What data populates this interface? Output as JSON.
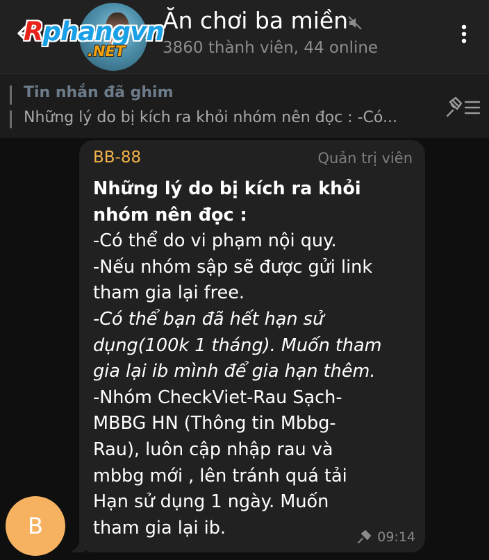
{
  "header": {
    "title": "Ăn chơi ba miền",
    "subtitle": "3860 thành viên, 44 online",
    "logo": {
      "main_first": "R",
      "main_rest": "phangvn",
      "sub": ".NET"
    }
  },
  "pinned": {
    "title": "Tin nhắn đã ghim",
    "preview": "Những lý do bị kích ra khỏi nhóm nên đọc : -Có..."
  },
  "message": {
    "sender": "BB-88",
    "role": "Quản trị viên",
    "lines": [
      "Những lý do bị kích ra khỏi",
      "nhóm nên đọc :",
      "-Có thể do vi phạm nội quy.",
      "-Nếu nhóm sập sẽ được gửi link",
      "tham gia lại free.",
      "-Có thể bạn đã hết hạn sử",
      "dụng(100k 1 tháng). Muốn tham",
      "gia lại ib mình để gia hạn thêm.",
      "-Nhóm CheckViet-Rau Sạch-",
      "MBBG HN (Thông tin Mbbg-",
      "Rau), luôn cập nhập rau và",
      "mbbg mới , lên tránh quá tải",
      "Hạn sử dụng 1 ngày.  Muốn",
      "tham gia lại ib."
    ],
    "time": "09:14",
    "avatar_initial": "B"
  },
  "colors": {
    "header_bg": "#212121",
    "chat_bg": "#0f0f0f",
    "bubble_bg": "#212121",
    "sender": "#f4b34a",
    "avatar": "#f6b260"
  },
  "icons": [
    "back-arrow-icon",
    "mute-icon",
    "more-vertical-icon",
    "pin-list-icon",
    "pin-icon"
  ]
}
